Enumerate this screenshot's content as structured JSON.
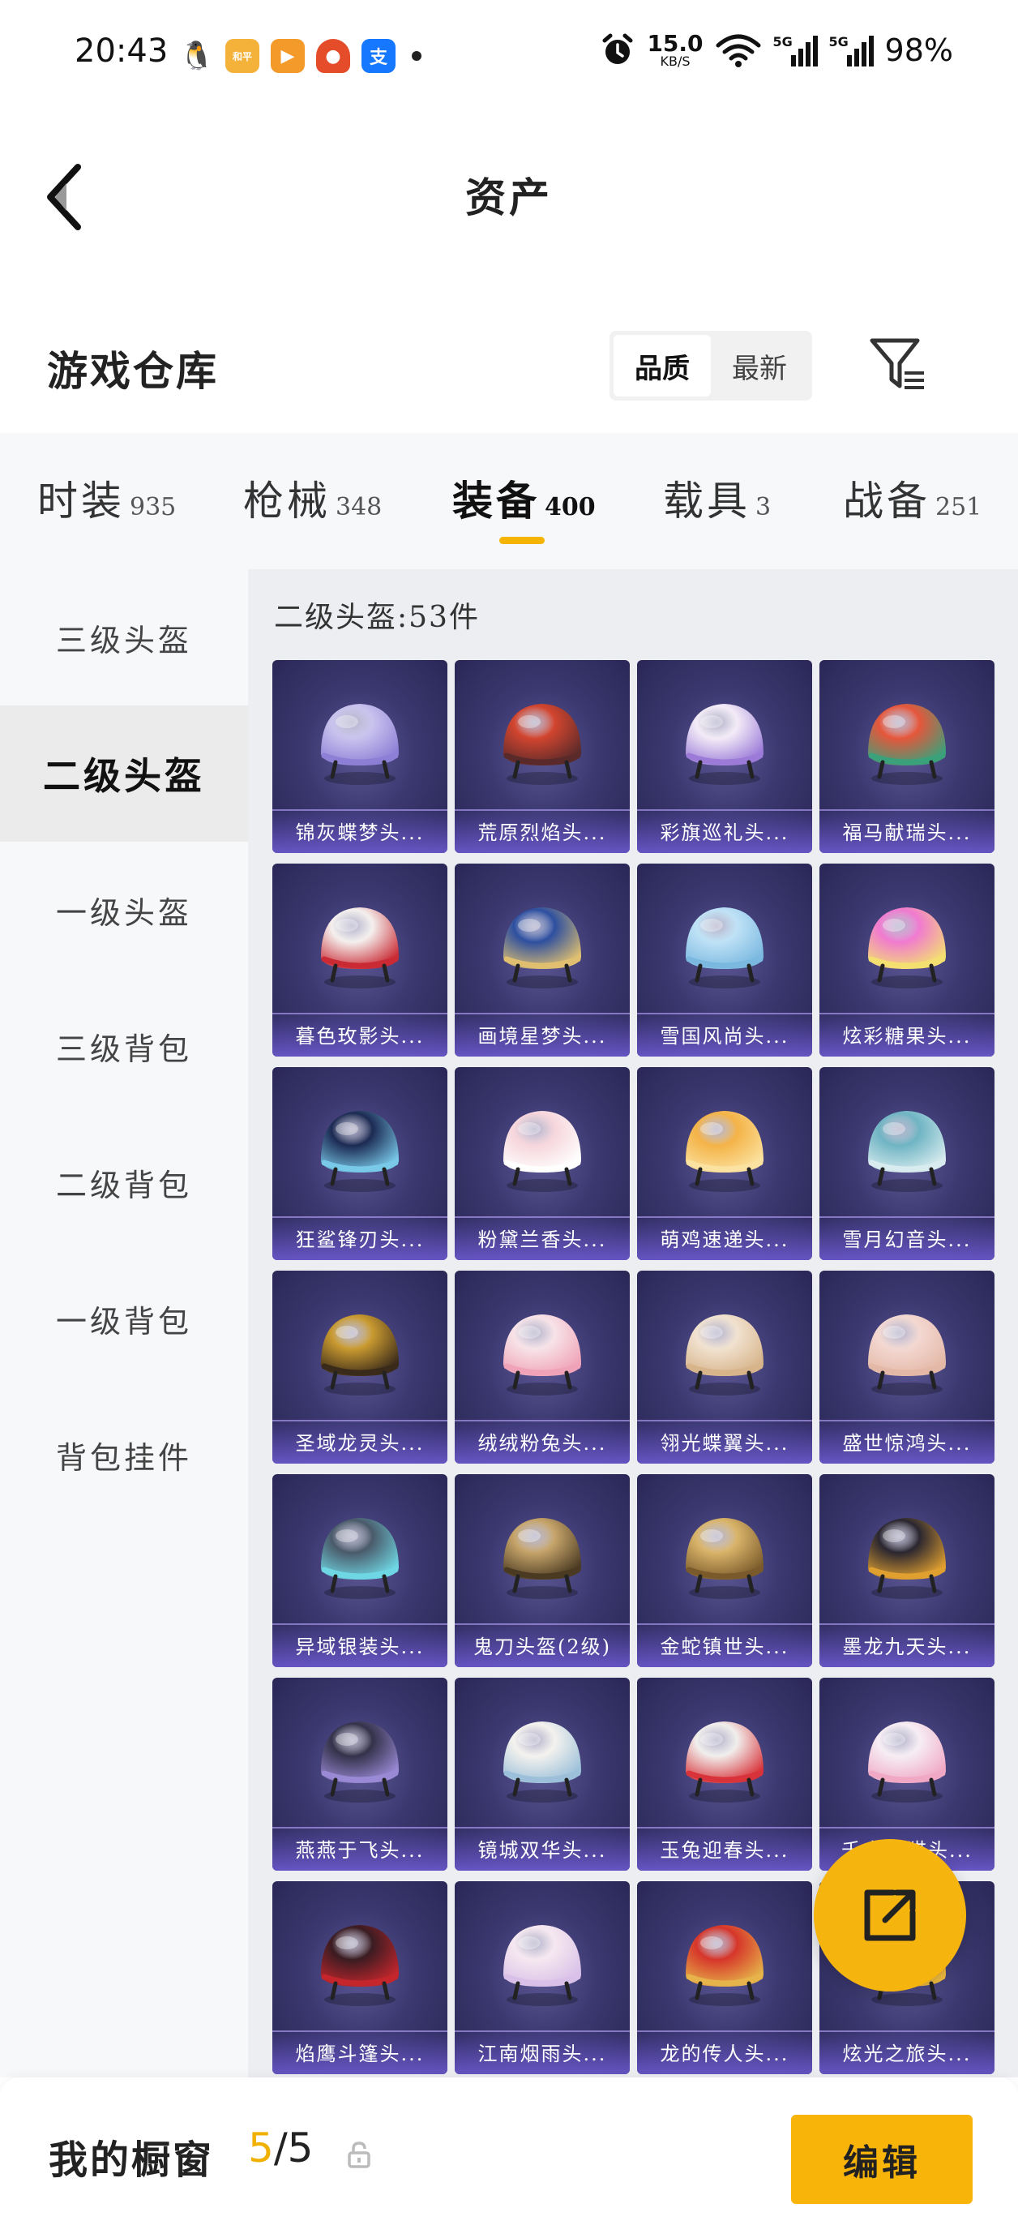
{
  "status_bar": {
    "time": "20:43",
    "apps": [
      {
        "icon": "qq-icon",
        "glyph": "🐧"
      },
      {
        "icon": "app-yellow-icon",
        "glyph": "和平"
      },
      {
        "icon": "video-app-icon",
        "glyph": "▶"
      },
      {
        "icon": "orange-app-icon",
        "glyph": "●"
      },
      {
        "icon": "alipay-icon",
        "glyph": "支"
      }
    ],
    "net_speed": "15.0",
    "net_unit": "KB/S",
    "sig1_label": "5G",
    "sig2_label": "5G",
    "battery": "98%"
  },
  "header": {
    "title": "资产"
  },
  "section": {
    "title": "游戏仓库",
    "sort_options": [
      "品质",
      "最新"
    ],
    "sort_active": 0
  },
  "tabs": [
    {
      "label": "时装",
      "count": "935"
    },
    {
      "label": "枪械",
      "count": "348"
    },
    {
      "label": "装备",
      "count": "400"
    },
    {
      "label": "载具",
      "count": "3"
    },
    {
      "label": "战备",
      "count": "251"
    }
  ],
  "active_tab": 2,
  "sidebar": [
    {
      "label": "三级头盔"
    },
    {
      "label": "二级头盔"
    },
    {
      "label": "一级头盔"
    },
    {
      "label": "三级背包"
    },
    {
      "label": "二级背包"
    },
    {
      "label": "一级背包"
    },
    {
      "label": "背包挂件"
    }
  ],
  "active_side": 1,
  "content": {
    "count_label": "二级头盔:53件"
  },
  "items": [
    {
      "name": "锦灰蝶梦头...",
      "c1": "#c9c3ee",
      "c2": "#8d7fd6"
    },
    {
      "name": "荒原烈焰头...",
      "c1": "#d2452f",
      "c2": "#5a2a2a"
    },
    {
      "name": "彩旗巡礼头...",
      "c1": "#f3ecf7",
      "c2": "#9b7ad8"
    },
    {
      "name": "福马献瑞头...",
      "c1": "#e6563b",
      "c2": "#3aa17a"
    },
    {
      "name": "暮色玫影头...",
      "c1": "#f4f0ee",
      "c2": "#c92a34"
    },
    {
      "name": "画境星梦头...",
      "c1": "#2d4fa0",
      "c2": "#e0c070"
    },
    {
      "name": "雪国风尚头...",
      "c1": "#bfe2f6",
      "c2": "#7ab8e0"
    },
    {
      "name": "炫彩糖果头...",
      "c1": "#f07ad0",
      "c2": "#f4e070"
    },
    {
      "name": "狂鲨锋刃头...",
      "c1": "#1c2a52",
      "c2": "#79c9e9"
    },
    {
      "name": "粉黛兰香头...",
      "c1": "#f6d6dc",
      "c2": "#ffffff"
    },
    {
      "name": "萌鸡速递头...",
      "c1": "#f4b347",
      "c2": "#fbe2a0"
    },
    {
      "name": "雪月幻音头...",
      "c1": "#6fb4c3",
      "c2": "#d8ecef"
    },
    {
      "name": "圣域龙灵头...",
      "c1": "#c99a30",
      "c2": "#3a2a1a"
    },
    {
      "name": "绒绒粉兔头...",
      "c1": "#f7e3e8",
      "c2": "#f0a3b8"
    },
    {
      "name": "翎光蝶翼头...",
      "c1": "#f1e2d0",
      "c2": "#d7b48a"
    },
    {
      "name": "盛世惊鸿头...",
      "c1": "#f3d8d2",
      "c2": "#e4b8a6"
    },
    {
      "name": "异域银装头...",
      "c1": "#4a5a6a",
      "c2": "#6fd7e4"
    },
    {
      "name": "鬼刀头盔(2级)",
      "c1": "#c6a46a",
      "c2": "#4a3a22"
    },
    {
      "name": "金蛇镇世头...",
      "c1": "#d9b46a",
      "c2": "#7a5a2a"
    },
    {
      "name": "墨龙九天头...",
      "c1": "#2a2630",
      "c2": "#e0a030"
    },
    {
      "name": "燕燕于飞头...",
      "c1": "#34324a",
      "c2": "#9a8ad6"
    },
    {
      "name": "镜城双华头...",
      "c1": "#f4f2ee",
      "c2": "#9cc0da"
    },
    {
      "name": "玉兔迎春头...",
      "c1": "#f1eeec",
      "c2": "#d8333a"
    },
    {
      "name": "千金...猫头...",
      "c1": "#f6eef4",
      "c2": "#f0a8c4"
    },
    {
      "name": "焰鹰斗篷头...",
      "c1": "#3a1c22",
      "c2": "#c4262c"
    },
    {
      "name": "江南烟雨头...",
      "c1": "#f6e8f0",
      "c2": "#d8c0e8"
    },
    {
      "name": "龙的传人头...",
      "c1": "#d6352a",
      "c2": "#e6b44a"
    },
    {
      "name": "炫光之旅头...",
      "c1": "#e6453a",
      "c2": "#f4c040"
    }
  ],
  "fab": {
    "icon": "share-icon"
  },
  "bottom": {
    "label": "我的橱窗",
    "current": "5",
    "separator": "/",
    "total": "5",
    "edit_label": "编辑"
  },
  "colors": {
    "accent": "#f6b40f",
    "card_bg": "#3b3870",
    "card_label_band": "#705cd6"
  }
}
